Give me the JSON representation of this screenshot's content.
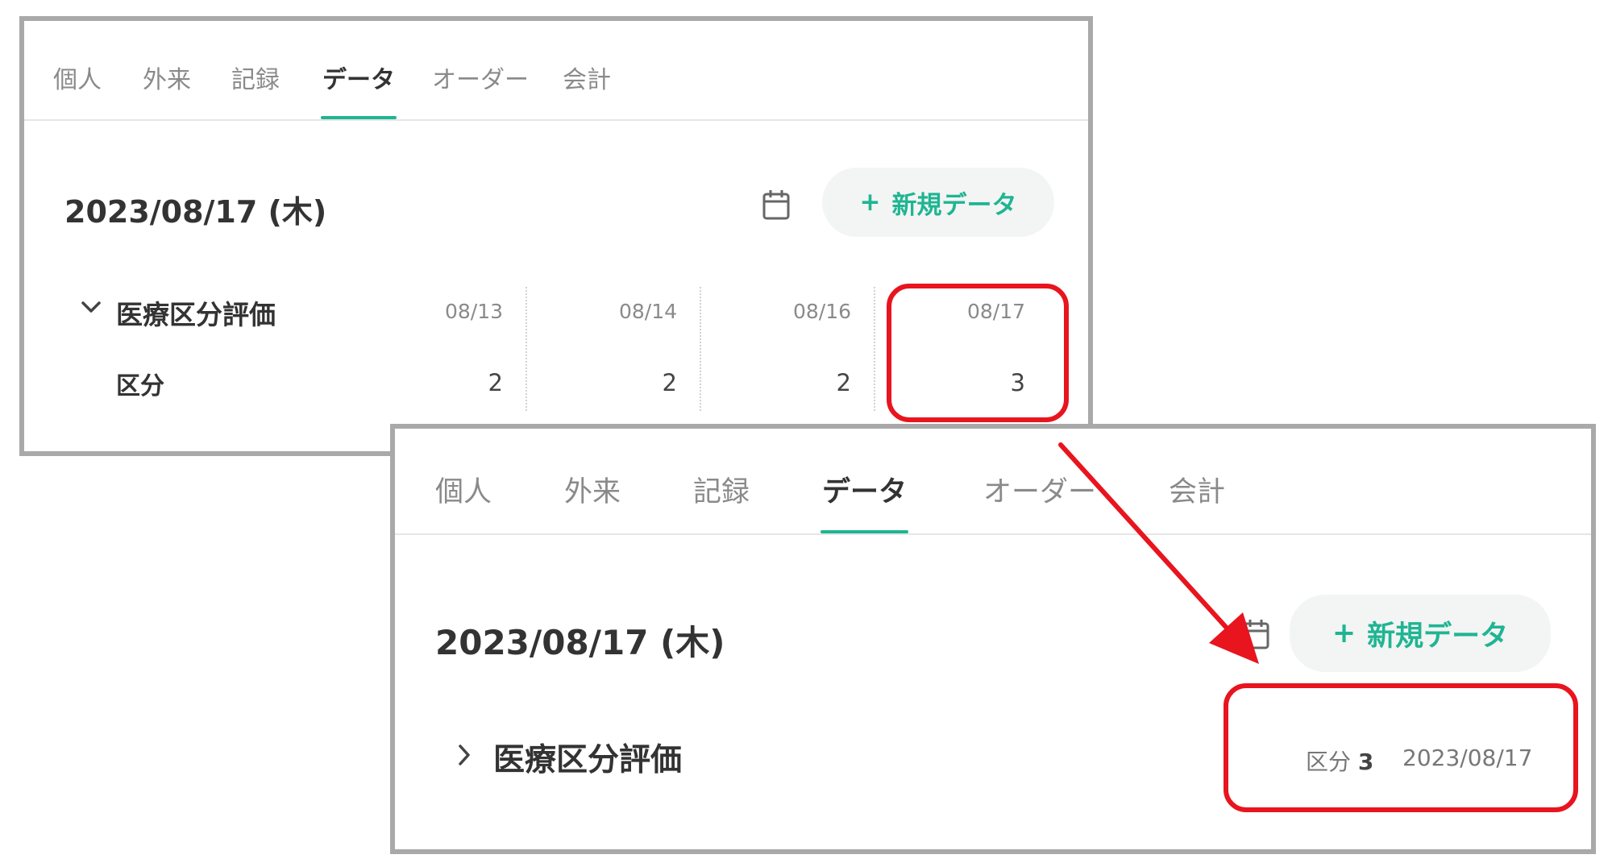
{
  "colors": {
    "accent": "#1fb592",
    "annotation": "#e8141e",
    "panel_border": "#a9a9a9"
  },
  "before": {
    "tabs": [
      {
        "label": "個人"
      },
      {
        "label": "外来"
      },
      {
        "label": "記録"
      },
      {
        "label": "データ",
        "active": true
      },
      {
        "label": "オーダー"
      },
      {
        "label": "会計"
      }
    ],
    "date": "2023/08/17 (木)",
    "calendar_icon": "calendar-icon",
    "new_button": {
      "icon": "plus-icon",
      "plus": "+",
      "label": "新規データ"
    },
    "section": {
      "title": "医療区分評価",
      "expanded": true,
      "chevron_icon": "chevron-down-icon",
      "row_label": "区分",
      "columns": [
        {
          "date": "08/13",
          "value": "2"
        },
        {
          "date": "08/14",
          "value": "2"
        },
        {
          "date": "08/16",
          "value": "2"
        },
        {
          "date": "08/17",
          "value": "3"
        }
      ]
    }
  },
  "after": {
    "tabs": [
      {
        "label": "個人"
      },
      {
        "label": "外来"
      },
      {
        "label": "記録"
      },
      {
        "label": "データ",
        "active": true
      },
      {
        "label": "オーダー"
      },
      {
        "label": "会計"
      }
    ],
    "date": "2023/08/17 (木)",
    "calendar_icon": "calendar-icon",
    "new_button": {
      "icon": "plus-icon",
      "plus": "+",
      "label": "新規データ"
    },
    "section": {
      "title": "医療区分評価",
      "expanded": false,
      "chevron_icon": "chevron-right-icon",
      "summary_label": "区分",
      "summary_value": "3",
      "summary_date": "2023/08/17"
    }
  },
  "annotations": {
    "arrow_icon": "red-arrow-icon",
    "highlight_style": "red rounded rectangle"
  }
}
